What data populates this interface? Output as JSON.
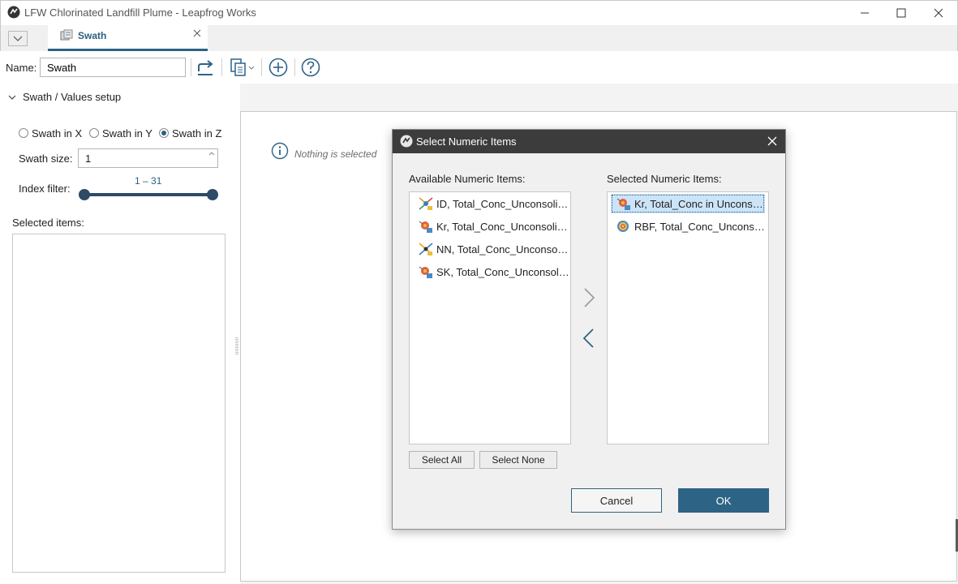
{
  "window": {
    "title": "LFW Chlorinated Landfill Plume - Leapfrog Works",
    "controls": {
      "minimize": "—",
      "maximize": "☐",
      "close": "✕"
    }
  },
  "tab": {
    "label": "Swath",
    "close_glyph": "✕"
  },
  "toolbar": {
    "name_label": "Name:",
    "name_value": "Swath",
    "icons": [
      "export-icon",
      "copy-icon",
      "add-icon",
      "help-icon"
    ]
  },
  "setup": {
    "section_title": "Swath / Values setup",
    "radios": [
      {
        "label": "Swath in X",
        "checked": false
      },
      {
        "label": "Swath in Y",
        "checked": false
      },
      {
        "label": "Swath in Z",
        "checked": true
      }
    ],
    "swath_size_label": "Swath size:",
    "swath_size_value": "1",
    "index_filter_label": "Index filter:",
    "index_range": "1 – 31",
    "index_min": 1,
    "index_max": 31,
    "selected_items_label": "Selected items:"
  },
  "main": {
    "empty_message": "Nothing is selected"
  },
  "dialog": {
    "title": "Select Numeric Items",
    "available_header": "Available Numeric Items:",
    "selected_header": "Selected Numeric Items:",
    "available": [
      {
        "label": "ID, Total_Conc_Unconsolidated",
        "icon": "idw-icon"
      },
      {
        "label": "Kr, Total_Conc_Unconsolidated",
        "icon": "kriging-icon"
      },
      {
        "label": "NN, Total_Conc_Unconsolidated",
        "icon": "nn-icon"
      },
      {
        "label": "SK, Total_Conc_Unconsolidated",
        "icon": "kriging-icon"
      }
    ],
    "selected": [
      {
        "label": "Kr, Total_Conc in Unconsolidated",
        "icon": "kriging-icon",
        "highlighted": true
      },
      {
        "label": "RBF, Total_Conc_Unconsolidated",
        "icon": "rbf-icon",
        "highlighted": false
      }
    ],
    "select_all": "Select All",
    "select_none": "Select None",
    "cancel": "Cancel",
    "ok": "OK"
  },
  "colors": {
    "accent": "#2d6385",
    "dialog_titlebar": "#3c3c3c",
    "selection": "#cce4f7"
  }
}
